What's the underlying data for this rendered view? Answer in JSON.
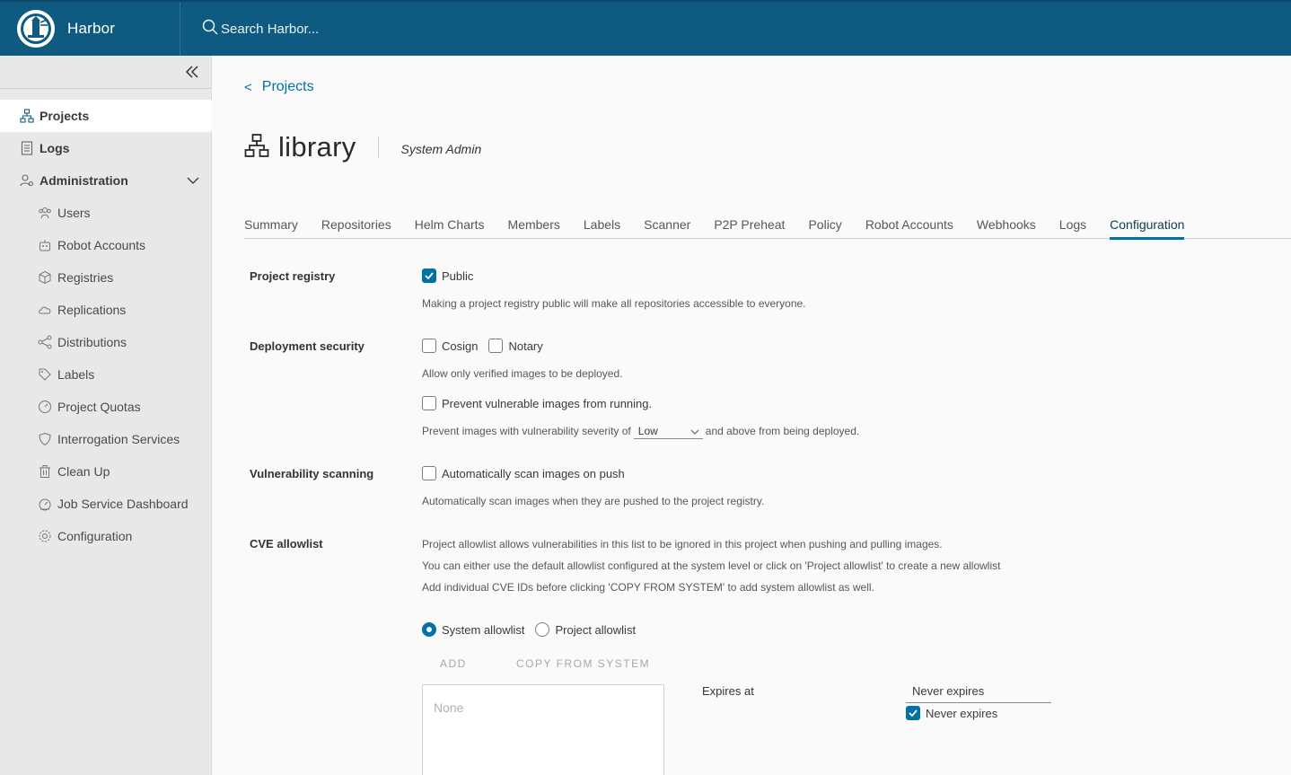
{
  "header": {
    "title": "Harbor",
    "search_placeholder": "Search Harbor..."
  },
  "sidebar": {
    "items": [
      {
        "label": "Projects",
        "icon": "projects-icon"
      },
      {
        "label": "Logs",
        "icon": "logs-icon"
      },
      {
        "label": "Administration",
        "icon": "admin-icon"
      }
    ],
    "admin_items": [
      {
        "label": "Users",
        "icon": "users-icon"
      },
      {
        "label": "Robot Accounts",
        "icon": "robot-icon"
      },
      {
        "label": "Registries",
        "icon": "registries-icon"
      },
      {
        "label": "Replications",
        "icon": "replications-icon"
      },
      {
        "label": "Distributions",
        "icon": "distributions-icon"
      },
      {
        "label": "Labels",
        "icon": "labels-icon"
      },
      {
        "label": "Project Quotas",
        "icon": "quotas-icon"
      },
      {
        "label": "Interrogation Services",
        "icon": "shield-icon"
      },
      {
        "label": "Clean Up",
        "icon": "trash-icon"
      },
      {
        "label": "Job Service Dashboard",
        "icon": "dashboard-icon"
      },
      {
        "label": "Configuration",
        "icon": "gear-icon"
      }
    ]
  },
  "breadcrumb": {
    "back": "<",
    "label": "Projects"
  },
  "project": {
    "name": "library",
    "role": "System Admin"
  },
  "tabs": [
    "Summary",
    "Repositories",
    "Helm Charts",
    "Members",
    "Labels",
    "Scanner",
    "P2P Preheat",
    "Policy",
    "Robot Accounts",
    "Webhooks",
    "Logs",
    "Configuration"
  ],
  "config": {
    "registry": {
      "label": "Project registry",
      "public_label": "Public",
      "help": "Making a project registry public will make all repositories accessible to everyone."
    },
    "deployment": {
      "label": "Deployment security",
      "cosign": "Cosign",
      "notary": "Notary",
      "help": "Allow only verified images to be deployed.",
      "prevent_label": "Prevent vulnerable images from running.",
      "severity_prefix": "Prevent images with vulnerability severity of",
      "severity_value": "Low",
      "severity_suffix": "and above from being deployed."
    },
    "scanning": {
      "label": "Vulnerability scanning",
      "auto_label": "Automatically scan images on push",
      "help": "Automatically scan images when they are pushed to the project registry."
    },
    "cve": {
      "label": "CVE allowlist",
      "help1": "Project allowlist allows vulnerabilities in this list to be ignored in this project when pushing and pulling images.",
      "help2": "You can either use the default allowlist configured at the system level or click on 'Project allowlist' to create a new allowlist",
      "help3": "Add individual CVE IDs before clicking 'COPY FROM SYSTEM' to add system allowlist as well.",
      "system_allowlist": "System allowlist",
      "project_allowlist": "Project allowlist",
      "add": "ADD",
      "copy": "COPY FROM SYSTEM",
      "list_empty": "None",
      "expires_label": "Expires at",
      "expires_value": "Never expires",
      "never_expires": "Never expires"
    }
  },
  "colors": {
    "header": "#0f5a80",
    "accent": "#0072a3",
    "sidebar": "#e8e8e8"
  }
}
